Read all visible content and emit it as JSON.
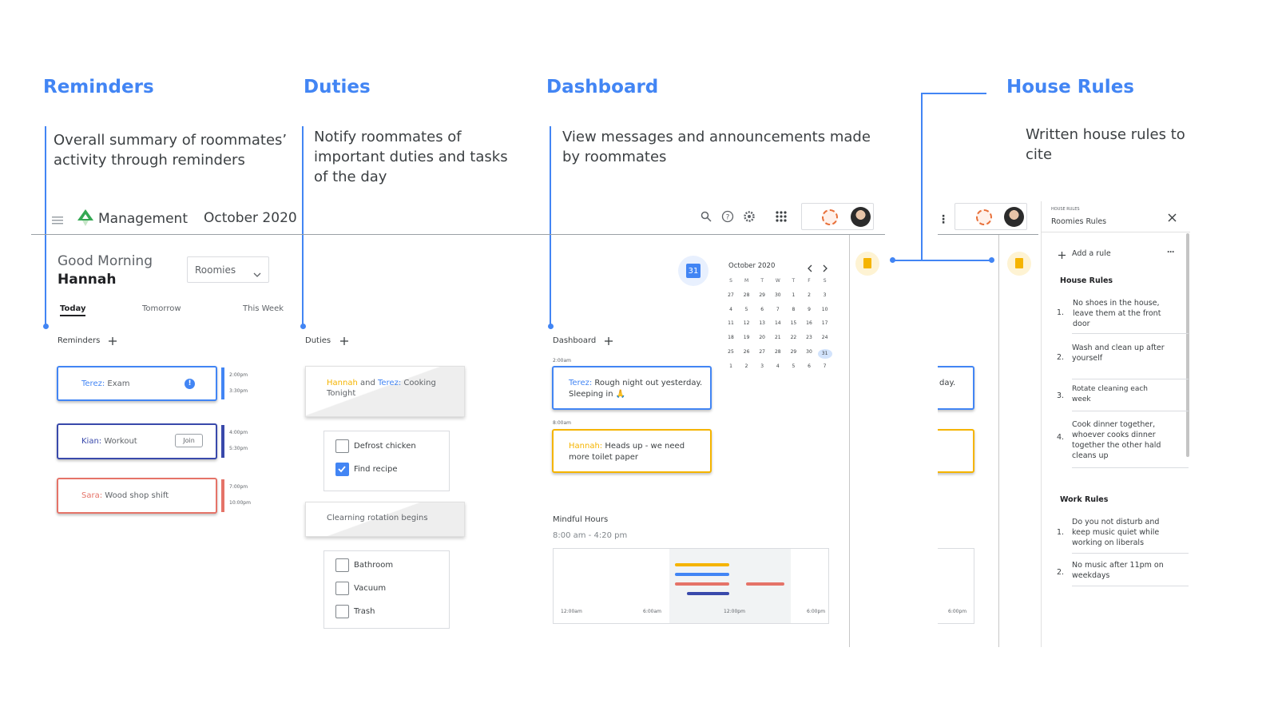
{
  "annotations": {
    "reminders": {
      "title": "Reminders",
      "desc_lines": [
        "Overall summary of roommates’",
        "activity through reminders"
      ]
    },
    "duties": {
      "title": "Duties",
      "desc_lines": [
        "Notify roommates of",
        "important duties and tasks",
        "of the day"
      ]
    },
    "dashboard": {
      "title": "Dashboard",
      "desc_lines": [
        "View messages and announcements made",
        "by roommates"
      ]
    },
    "house_rules": {
      "title": "House Rules",
      "desc_lines": [
        "Written house rules to",
        "cite"
      ]
    }
  },
  "header": {
    "app_name": "Management",
    "month": "October 2020",
    "icons": [
      "menu-icon",
      "logo-icon",
      "search-icon",
      "help-icon",
      "settings-icon",
      "apps-grid-icon"
    ]
  },
  "greeting": {
    "line1": "Good Morning",
    "name": "Hannah"
  },
  "group_select": {
    "value": "Roomies"
  },
  "tabs": [
    "Today",
    "Tomorrow",
    "This Week"
  ],
  "reminders": {
    "label": "Reminders",
    "items": [
      {
        "who": "Terez:",
        "what": "Exam",
        "color": "#4285f4",
        "t1": "2:00pm",
        "t2": "3:30pm"
      },
      {
        "who": "Kian:",
        "what": "Workout",
        "color": "#3949ab",
        "t1": "4:00pm",
        "t2": "5:30pm",
        "action": "Join"
      },
      {
        "who": "Sara:",
        "what": "Wood shop shift",
        "color": "#e57368",
        "t1": "7:00pm",
        "t2": "10:00pm"
      }
    ]
  },
  "duties": {
    "label": "Duties",
    "card1": {
      "name1": "Hannah",
      "and": " and ",
      "name2": "Terez:",
      "task": " Cooking",
      "line2": "Tonight"
    },
    "list1": [
      {
        "label": "Defrost chicken",
        "checked": false
      },
      {
        "label": "Find recipe",
        "checked": true
      }
    ],
    "card2": "Clearning rotation begins",
    "list2": [
      {
        "label": "Bathroom",
        "checked": false
      },
      {
        "label": "Vacuum",
        "checked": false
      },
      {
        "label": "Trash",
        "checked": false
      }
    ]
  },
  "dashboard": {
    "label": "Dashboard",
    "msg1": {
      "time": "2:00am",
      "who": "Terez:",
      "text1": " Rough night out yesterday.",
      "text2": "Sleeping in 🙏"
    },
    "msg2": {
      "time": "8:00am",
      "who": "Hannah:",
      "text1": " Heads up - we need",
      "text2": "more toilet paper"
    },
    "mindful": {
      "title": "Mindful Hours",
      "range": "8:00 am - 4:20 pm",
      "ticks": [
        "12:00am",
        "6:00am",
        "12:00pm",
        "6:00pm"
      ]
    },
    "cal_icon_day": "31"
  },
  "calendar": {
    "title": "October 2020",
    "dow": [
      "S",
      "M",
      "T",
      "W",
      "T",
      "F",
      "S"
    ],
    "weeks": [
      [
        "27",
        "28",
        "29",
        "30",
        "1",
        "2",
        "3"
      ],
      [
        "4",
        "5",
        "6",
        "7",
        "8",
        "9",
        "10"
      ],
      [
        "11",
        "12",
        "13",
        "14",
        "15",
        "16",
        "17"
      ],
      [
        "18",
        "19",
        "20",
        "21",
        "22",
        "23",
        "24"
      ],
      [
        "25",
        "26",
        "27",
        "28",
        "29",
        "30",
        "31"
      ],
      [
        "1",
        "2",
        "3",
        "4",
        "5",
        "6",
        "7"
      ]
    ],
    "selected": "31"
  },
  "side_panel": {
    "eyebrow": "HOUSE RULES",
    "title": "Roomies Rules",
    "add_label": "Add a rule",
    "house_rules_title": "House Rules",
    "house_rules": [
      {
        "num": "1.",
        "lines": [
          "No shoes in the house,",
          "leave them at the front",
          "door"
        ]
      },
      {
        "num": "2.",
        "lines": [
          "Wash and clean up after",
          "yourself"
        ]
      },
      {
        "num": "3.",
        "lines": [
          "Rotate cleaning each",
          "week"
        ]
      },
      {
        "num": "4.",
        "lines": [
          "Cook dinner together,",
          "whoever cooks dinner",
          "together the other hald",
          "cleans up"
        ]
      }
    ],
    "work_rules_title": "Work Rules",
    "work_rules": [
      {
        "num": "1.",
        "lines": [
          "Do you not disturb and",
          "keep music quiet while",
          "working on liberals"
        ]
      },
      {
        "num": "2.",
        "lines": [
          "No music after 11pm on",
          "weekdays"
        ]
      }
    ]
  },
  "clipped_panel": {
    "msg_fragment": "day.",
    "tick": "6:00pm"
  },
  "colors": {
    "accent": "#4285f4",
    "orange": "#f5b400",
    "salmon": "#e57368",
    "indigo": "#3949ab"
  }
}
